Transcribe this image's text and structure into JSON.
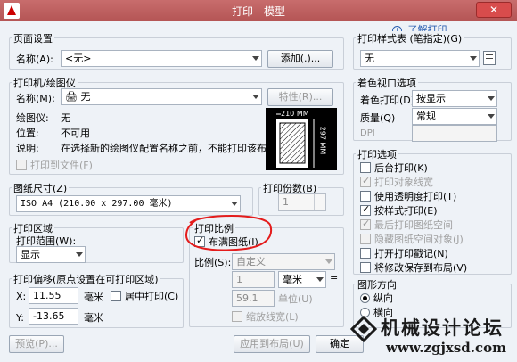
{
  "window": {
    "title": "打印 - 模型",
    "close": "✕"
  },
  "help_link": "了解打印",
  "page_setup": {
    "group_label": "页面设置",
    "name_label": "名称(A):",
    "name_value": "<无>",
    "add_button": "添加(.)..."
  },
  "printer": {
    "group_label": "打印机/绘图仪",
    "name_label": "名称(M):",
    "name_value": "无",
    "properties_button": "特性(R)...",
    "plotter_label": "绘图仪:",
    "plotter_value": "无",
    "location_label": "位置:",
    "location_value": "不可用",
    "desc_label": "说明:",
    "desc_value": "在选择新的绘图仪配置名称之前，不能打印该布局。",
    "print_to_file": "打印到文件(F)",
    "preview_width": "210 MM",
    "preview_height": "297 MM"
  },
  "paper_size": {
    "group_label": "图纸尺寸(Z)",
    "value": "ISO A4 (210.00 x 297.00 毫米)"
  },
  "copies": {
    "group_label": "打印份数(B)",
    "value": "1"
  },
  "plot_area": {
    "group_label": "打印区域",
    "range_label": "打印范围(W):",
    "range_value": "显示"
  },
  "plot_scale": {
    "group_label": "打印比例",
    "fit_paper": "布满图纸(I)",
    "scale_label": "比例(S):",
    "scale_value": "自定义",
    "num_value": "1",
    "unit_value": "毫米",
    "eq": "=",
    "unit_num": "59.1",
    "unit_label": "单位(U)",
    "scale_lineweights": "缩放线宽(L)"
  },
  "plot_offset": {
    "group_label": "打印偏移(原点设置在可打印区域)",
    "x_label": "X:",
    "x_value": "11.55",
    "x_unit": "毫米",
    "center": "居中打印(C)",
    "y_label": "Y:",
    "y_value": "-13.65",
    "y_unit": "毫米"
  },
  "plot_style": {
    "group_label": "打印样式表 (笔指定)(G)",
    "value": "无"
  },
  "shaded": {
    "group_label": "着色视口选项",
    "shade_label": "着色打印(D)",
    "shade_value": "按显示",
    "quality_label": "质量(Q)",
    "quality_value": "常规",
    "dpi_label": "DPI"
  },
  "options": {
    "group_label": "打印选项",
    "items": [
      "后台打印(K)",
      "打印对象线宽",
      "使用透明度打印(T)",
      "按样式打印(E)",
      "最后打印图纸空间",
      "隐藏图纸空间对象(J)",
      "打开打印戳记(N)",
      "将修改保存到布局(V)"
    ]
  },
  "orientation": {
    "group_label": "图形方向",
    "portrait": "纵向",
    "landscape": "横向"
  },
  "footer": {
    "preview_button": "预览(P)...",
    "apply_button": "应用到布局(U)",
    "ok_button": "确定"
  },
  "watermark": {
    "text_cn": "机械设计论坛",
    "url": "www.zgjxsd.com"
  }
}
